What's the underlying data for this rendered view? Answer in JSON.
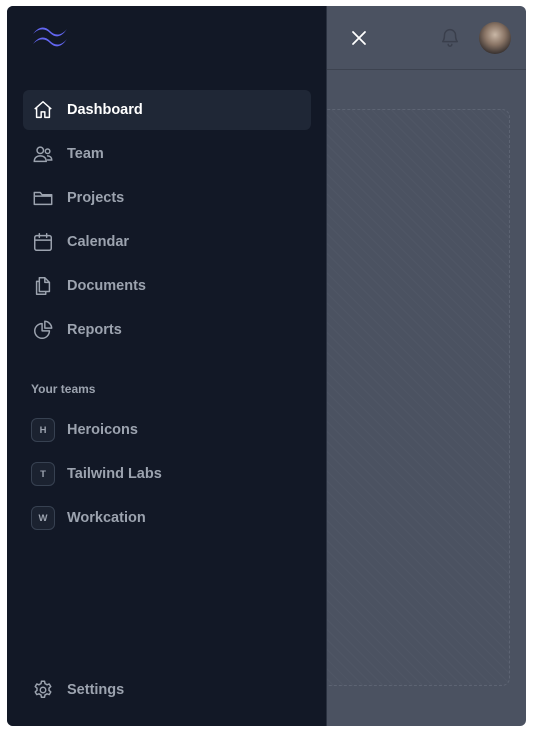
{
  "nav": {
    "items": [
      {
        "label": "Dashboard",
        "icon": "home-icon",
        "active": true
      },
      {
        "label": "Team",
        "icon": "users-icon"
      },
      {
        "label": "Projects",
        "icon": "folder-icon"
      },
      {
        "label": "Calendar",
        "icon": "calendar-icon"
      },
      {
        "label": "Documents",
        "icon": "documents-icon"
      },
      {
        "label": "Reports",
        "icon": "chart-pie-icon"
      }
    ]
  },
  "teams": {
    "title": "Your teams",
    "items": [
      {
        "initial": "H",
        "label": "Heroicons"
      },
      {
        "initial": "T",
        "label": "Tailwind Labs"
      },
      {
        "initial": "W",
        "label": "Workcation"
      }
    ]
  },
  "settings": {
    "label": "Settings",
    "icon": "gear-icon"
  },
  "colors": {
    "sidebar_bg": "#121826",
    "active_bg": "#1f2736",
    "logo_accent": "#6366f1",
    "overlay": "#4b5261"
  },
  "icons": {
    "logo": "tailwind-logo-icon",
    "close": "close-icon",
    "bell": "bell-icon",
    "avatar": "user-avatar"
  }
}
